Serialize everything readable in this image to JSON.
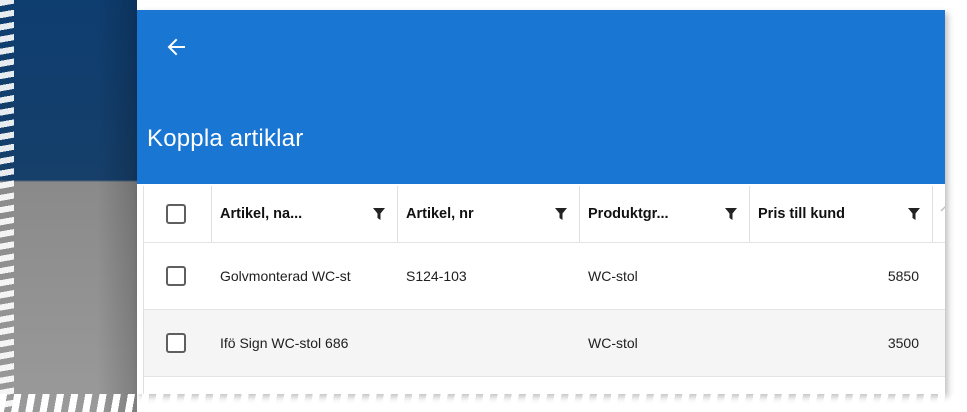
{
  "header": {
    "back_icon": "arrow-left-icon",
    "title": "Koppla artiklar",
    "accent_color": "#1976d2"
  },
  "grid": {
    "columns": [
      {
        "label": "Artikel, na...",
        "icon": "filter-icon"
      },
      {
        "label": "Artikel, nr",
        "icon": "filter-icon"
      },
      {
        "label": "Produktgr...",
        "icon": "filter-icon"
      },
      {
        "label": "Pris till kund",
        "icon": "filter-icon"
      }
    ],
    "rows": [
      {
        "name": "Golvmonterad WC-st",
        "nr": "S124-103",
        "group": "WC-stol",
        "price": "5850"
      },
      {
        "name": "Ifö Sign WC-stol 686",
        "nr": "",
        "group": "WC-stol",
        "price": "3500"
      }
    ]
  }
}
